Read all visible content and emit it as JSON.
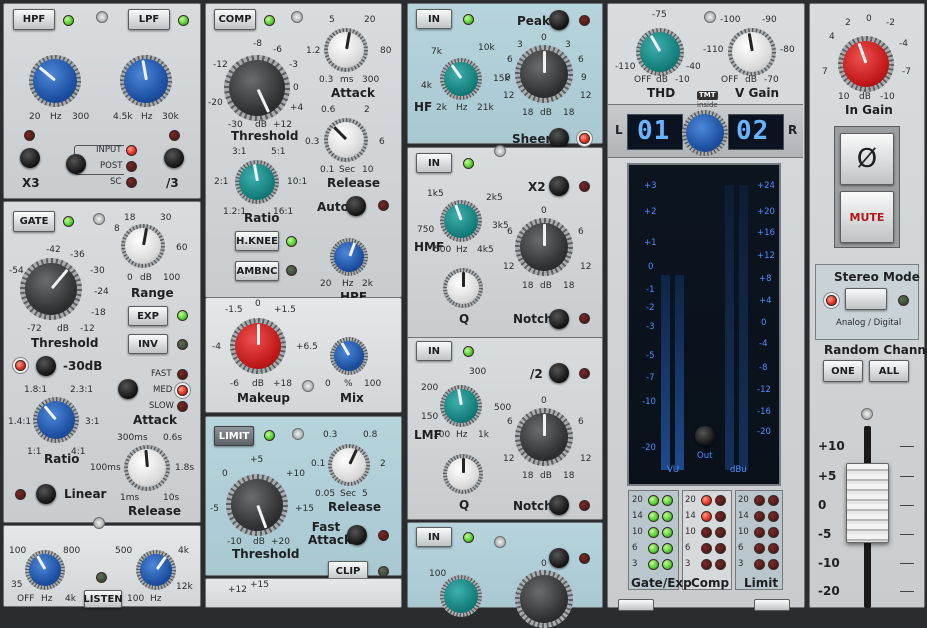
{
  "filters": {
    "hpf_label": "HPF",
    "lpf_label": "LPF",
    "hpf_scale": [
      "20",
      "Hz",
      "300"
    ],
    "lpf_scale": [
      "4.5k",
      "Hz",
      "30k"
    ],
    "input_label": "INPUT",
    "post_label": "POST",
    "sc_label": "SC",
    "x3_label": "X3",
    "div3_label": "/3"
  },
  "gate": {
    "button": "GATE",
    "range_label": "Range",
    "range_scale": [
      "8",
      "18",
      "30",
      "60",
      "100",
      "0",
      "dB"
    ],
    "threshold_label": "Threshold",
    "threshold_scale": [
      "-42",
      "-36",
      "-54",
      "-30",
      "-24",
      "-18",
      "-12",
      "-72",
      "dB"
    ],
    "exp_label": "EXP",
    "inv_label": "INV",
    "minus30_label": "-30dB",
    "fast_label": "FAST",
    "med_label": "MED",
    "slow_label": "SLOW",
    "attack_label": "Attack",
    "ratio_label": "Ratio",
    "ratio_scale": [
      "1.8:1",
      "2.3:1",
      "1.4:1",
      "3:1",
      "1:1",
      "4:1"
    ],
    "release_label": "Release",
    "release_scale": [
      "300ms",
      "0.6s",
      "100ms",
      "1.8s",
      "1ms",
      "10s"
    ],
    "linear_label": "Linear"
  },
  "bottom_left": {
    "hpf_scale": [
      "100",
      "800",
      "35",
      "OFF",
      "Hz",
      "4k"
    ],
    "lpf_scale": [
      "500",
      "4k",
      "100",
      "Hz",
      "12k"
    ],
    "listen_label": "LISTEN"
  },
  "comp": {
    "button": "COMP",
    "attack_label": "Attack",
    "attack_scale": [
      "5",
      "20",
      "1.2",
      "80",
      "0.3",
      "ms",
      "300"
    ],
    "threshold_label": "Threshold",
    "threshold_scale": [
      "-8",
      "-6",
      "-12",
      "-3",
      "-20",
      "0",
      "+4",
      "-30",
      "dB",
      "+12"
    ],
    "release_label": "Release",
    "release_scale": [
      "0.6",
      "2",
      "0.3",
      "6",
      "0.1",
      "Sec",
      "10"
    ],
    "ratio_label": "Ratio",
    "ratio_scale": [
      "3:1",
      "5:1",
      "2:1",
      "10:1",
      "1.2:1",
      "16:1"
    ],
    "auto_label": "Auto",
    "hknee_label": "H.KNEE",
    "ambnc_label": "AMBNC",
    "hpf_label": "HPF",
    "hpf_scale": [
      "20",
      "Hz",
      "2k"
    ],
    "makeup_label": "Makeup",
    "makeup_scale": [
      "-1.5",
      "0",
      "+1.5",
      "-4",
      "+6.5",
      "-6",
      "dB",
      "+18"
    ],
    "mix_label": "Mix",
    "mix_scale": [
      "0",
      "%",
      "100"
    ]
  },
  "limit": {
    "button": "LIMIT",
    "release_label": "Release",
    "release_scale": [
      "0.3",
      "0.8",
      "0.1",
      "2",
      "0.05",
      "Sec",
      "5"
    ],
    "threshold_label": "Threshold",
    "threshold_scale": [
      "+5",
      "0",
      "+10",
      "-5",
      "+15",
      "-10",
      "dB",
      "+20"
    ],
    "fast_attack_label": "Fast Attack",
    "clip_label": "CLIP",
    "bottom_scale": [
      "+12",
      "+15"
    ]
  },
  "eq": {
    "in_label": "IN",
    "peak_label": "Peak",
    "sheen_label": "Sheen",
    "x2_label": "X2",
    "notch_label": "Notch",
    "div2_label": "/2",
    "hf_scale": [
      "7k",
      "10k",
      "4k",
      "15k",
      "2k",
      "Hz",
      "21k"
    ],
    "gain_scale": [
      "0",
      "3",
      "3",
      "6",
      "6",
      "9",
      "9",
      "12",
      "12",
      "18",
      "dB",
      "18"
    ],
    "hmf_scale": [
      "1k5",
      "2k5",
      "750",
      "3k5",
      "500",
      "Hz",
      "4k5"
    ],
    "lmf_scale": [
      "200",
      "300",
      "150",
      "500",
      "100",
      "Hz",
      "1k"
    ],
    "hf_side": "HF",
    "hmf_side": "HMF",
    "lmf_side": "LMF",
    "q_label": "Q",
    "bottom_scale": [
      "100",
      "0"
    ]
  },
  "output": {
    "thd_label": "THD",
    "thd_scale": [
      "-75",
      "-110",
      "-40",
      "OFF",
      "dB",
      "-10"
    ],
    "vgain_label": "V Gain",
    "vgain_scale": [
      "-100",
      "-90",
      "-110",
      "-80",
      "OFF",
      "dB",
      "-70"
    ],
    "tmt_label": "TMT",
    "inside_label": "inside",
    "l_label": "L",
    "r_label": "R",
    "left_digit": "01",
    "right_digit": "02",
    "vu_scale": [
      "+3",
      "+2",
      "+1",
      "0",
      "-1",
      "-2",
      "-3",
      "-5",
      "-7",
      "-10",
      "-20"
    ],
    "dbu_scale": [
      "+24",
      "+20",
      "+16",
      "+12",
      "+8",
      "+4",
      "0",
      "-4",
      "-8",
      "-12",
      "-16",
      "-20"
    ],
    "vu_label": "VU",
    "out_label": "Out",
    "dbu_label": "dBu",
    "gr_rows": [
      "20",
      "14",
      "10",
      "6",
      "3"
    ],
    "gate_exp_label": "Gate/Exp",
    "comp_label": "Comp",
    "limit_label": "Limit"
  },
  "master": {
    "in_gain_label": "In Gain",
    "in_gain_scale": [
      "2",
      "0",
      "4",
      "-2",
      "7",
      "-4",
      "10",
      "-7",
      "-10",
      "dB"
    ],
    "phase_symbol": "Ø",
    "mute_label": "MUTE",
    "stereo_mode_label": "Stereo Mode",
    "analog_digital_label": "Analog / Digital",
    "random_channel_label": "Random Channel",
    "one_label": "ONE",
    "all_label": "ALL",
    "fader_scale": [
      "+10",
      "+5",
      "0",
      "-5",
      "-10",
      "-20"
    ]
  },
  "colors": {
    "accent_red": "#d62a20",
    "accent_green": "#52d12e",
    "meter_blue": "#4d8fff",
    "knob_blue": "#1c4ea0",
    "knob_teal": "#137d7a"
  }
}
